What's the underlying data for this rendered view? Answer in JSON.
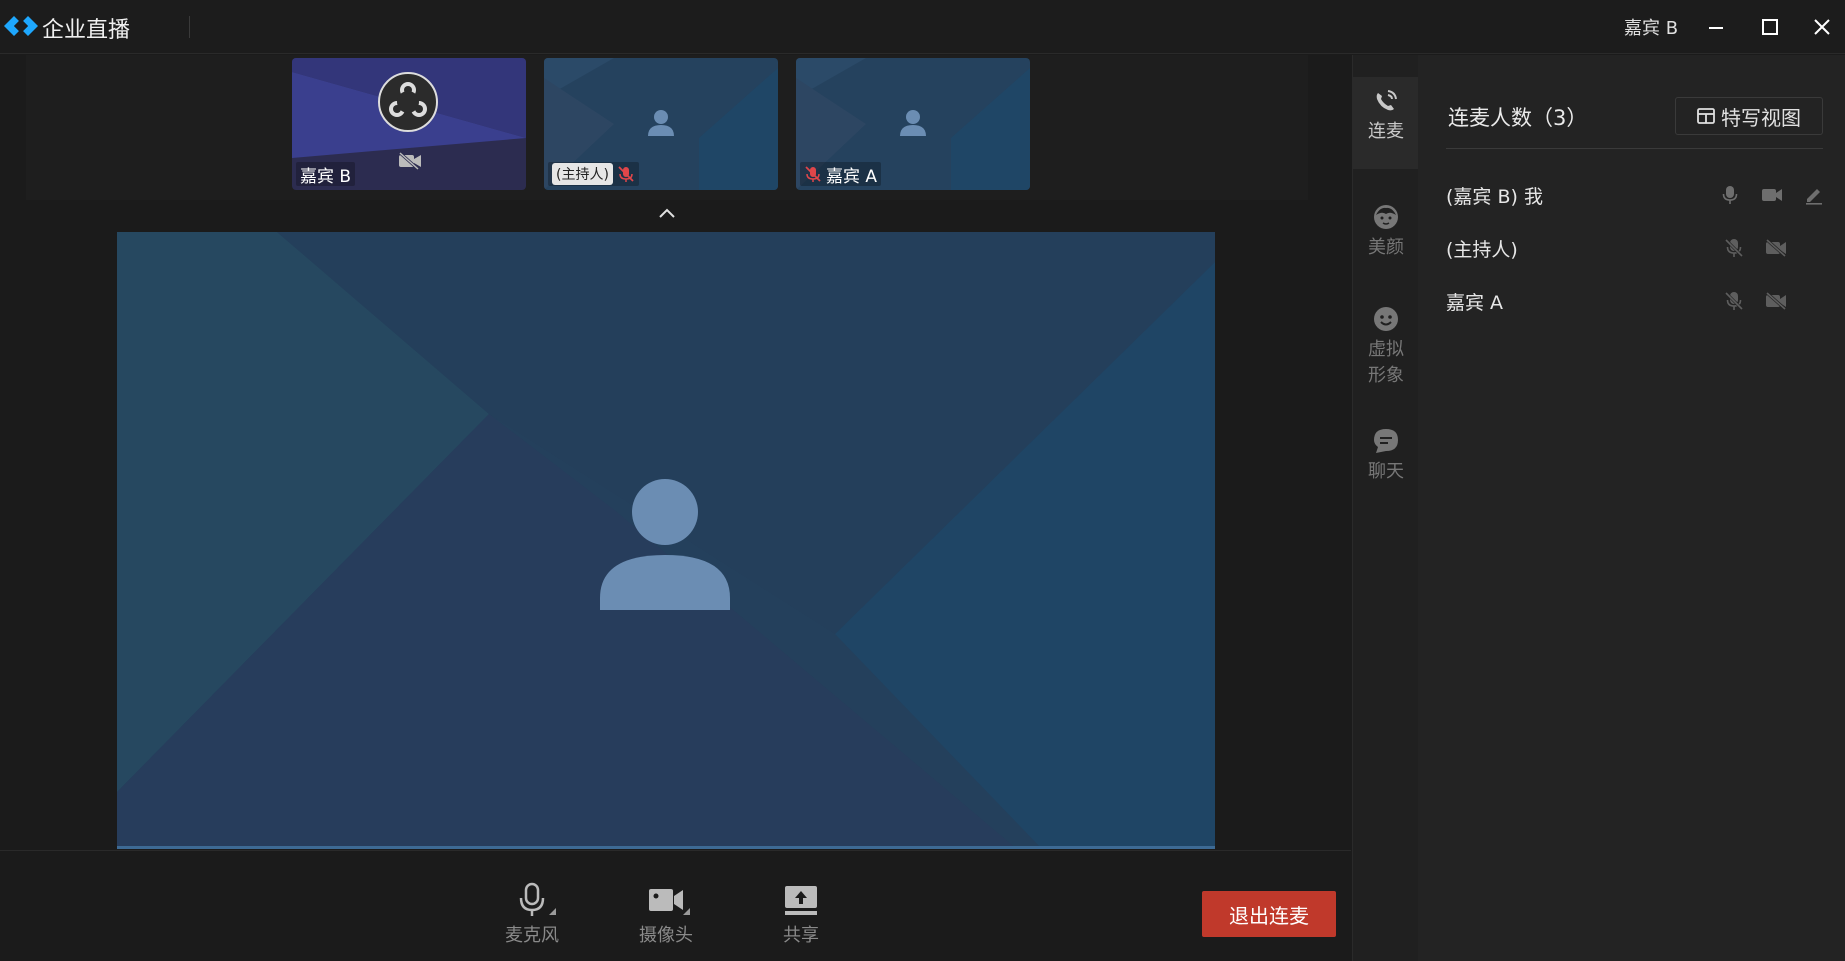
{
  "app": {
    "title": "企业直播",
    "user": "嘉宾 B"
  },
  "thumbnails": [
    {
      "name": "嘉宾 B",
      "tag": "",
      "mic_muted": false,
      "camera_off": true
    },
    {
      "name": "",
      "tag": "(主持人)",
      "mic_muted": true,
      "camera_off": false
    },
    {
      "name": "嘉宾 A",
      "tag": "",
      "mic_muted": true,
      "camera_off": false
    }
  ],
  "controls": {
    "mic_label": "麦克风",
    "camera_label": "摄像头",
    "share_label": "共享",
    "leave_label": "退出连麦"
  },
  "rail": {
    "tabs": [
      {
        "label": "连麦",
        "icon": "phone-wave-icon",
        "active": true
      },
      {
        "label": "美颜",
        "icon": "face-beauty-icon",
        "active": false
      },
      {
        "label": "虚拟\n形象",
        "icon": "smiley-icon",
        "active": false
      },
      {
        "label": "聊天",
        "icon": "chat-bubble-icon",
        "active": false
      }
    ]
  },
  "panel": {
    "title": "连麦人数（3）",
    "feature_view_label": "特写视图",
    "members": [
      {
        "name": "(嘉宾 B) 我",
        "mic": "on",
        "camera": "on",
        "editable": true
      },
      {
        "name": "(主持人)",
        "mic": "off",
        "camera": "off",
        "editable": false
      },
      {
        "name": "嘉宾 A",
        "mic": "off",
        "camera": "off",
        "editable": false
      }
    ]
  },
  "colors": {
    "accent_red": "#c0392b",
    "video_blue": "#234a6e",
    "muted_red": "#e0464a",
    "brand_cyan": "#1ea7fd"
  }
}
